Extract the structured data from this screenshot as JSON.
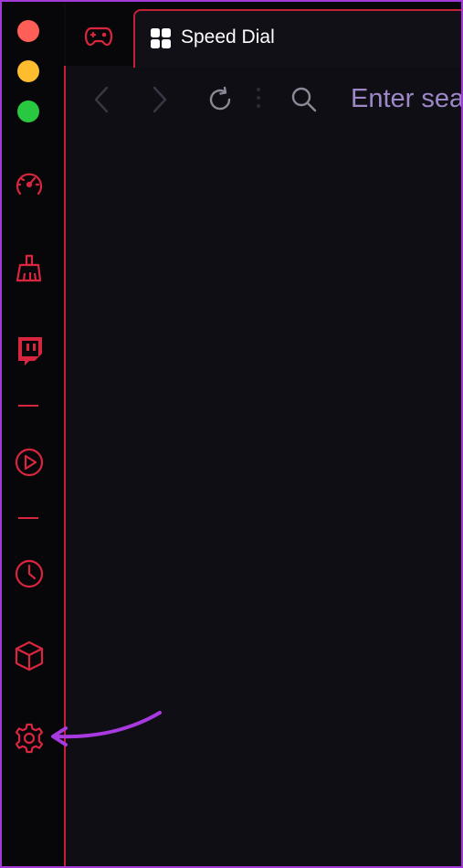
{
  "window": {
    "traffic_lights": [
      "close",
      "minimize",
      "maximize"
    ]
  },
  "sidebar": {
    "items": [
      {
        "icon": "speedometer-icon"
      },
      {
        "icon": "cleaner-icon"
      },
      {
        "icon": "twitch-icon"
      },
      {
        "icon": "player-icon"
      },
      {
        "icon": "history-icon"
      },
      {
        "icon": "extensions-cube-icon"
      },
      {
        "icon": "settings-gear-icon"
      }
    ]
  },
  "tabs": {
    "pinned_icon": "gamepad-icon",
    "active": {
      "icon": "speed-dial-grid-icon",
      "title": "Speed Dial"
    }
  },
  "toolbar": {
    "address_placeholder": "Enter sea"
  },
  "colors": {
    "accent": "#d9263f",
    "annotation_arrow": "#a83ae0",
    "address_text": "#9d87c6"
  }
}
